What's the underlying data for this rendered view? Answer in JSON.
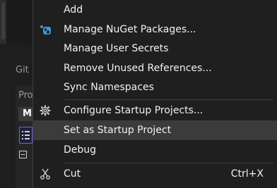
{
  "background_panel": {
    "tab_partial": "Git",
    "panel_title_partial": "Pro",
    "panel_header_partial": "M"
  },
  "context_menu": {
    "items": [
      {
        "label": "Add",
        "icon": null
      },
      {
        "label": "Manage NuGet Packages...",
        "icon": "nuget-icon"
      },
      {
        "label": "Manage User Secrets",
        "icon": null
      },
      {
        "label": "Remove Unused References...",
        "icon": null
      },
      {
        "label": "Sync Namespaces",
        "icon": null
      },
      {
        "label": "Configure Startup Projects...",
        "icon": "gear-icon"
      },
      {
        "label": "Set as Startup Project",
        "icon": null,
        "selected": true
      },
      {
        "label": "Debug",
        "icon": null
      },
      {
        "label": "Cut",
        "icon": "scissors-icon",
        "shortcut": "Ctrl+X"
      }
    ]
  },
  "colors": {
    "menu_bg": "#1f1f1f",
    "hover_bg": "#3b3b3b",
    "text": "#f1f1f1",
    "nuget_blue": "#3a9bd8"
  }
}
